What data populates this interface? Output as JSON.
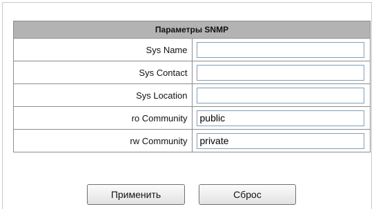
{
  "panel": {
    "title": "Параметры SNMP"
  },
  "fields": [
    {
      "label": "Sys Name",
      "value": ""
    },
    {
      "label": "Sys Contact",
      "value": ""
    },
    {
      "label": "Sys Location",
      "value": ""
    },
    {
      "label": "ro Community",
      "value": "public"
    },
    {
      "label": "rw Community",
      "value": "private"
    }
  ],
  "buttons": {
    "apply_label": "Применить",
    "reset_label": "Сброс"
  },
  "colors": {
    "header_bg": "#b3b3b3",
    "border": "#8c8c8c",
    "input_border": "#7f9db9"
  }
}
